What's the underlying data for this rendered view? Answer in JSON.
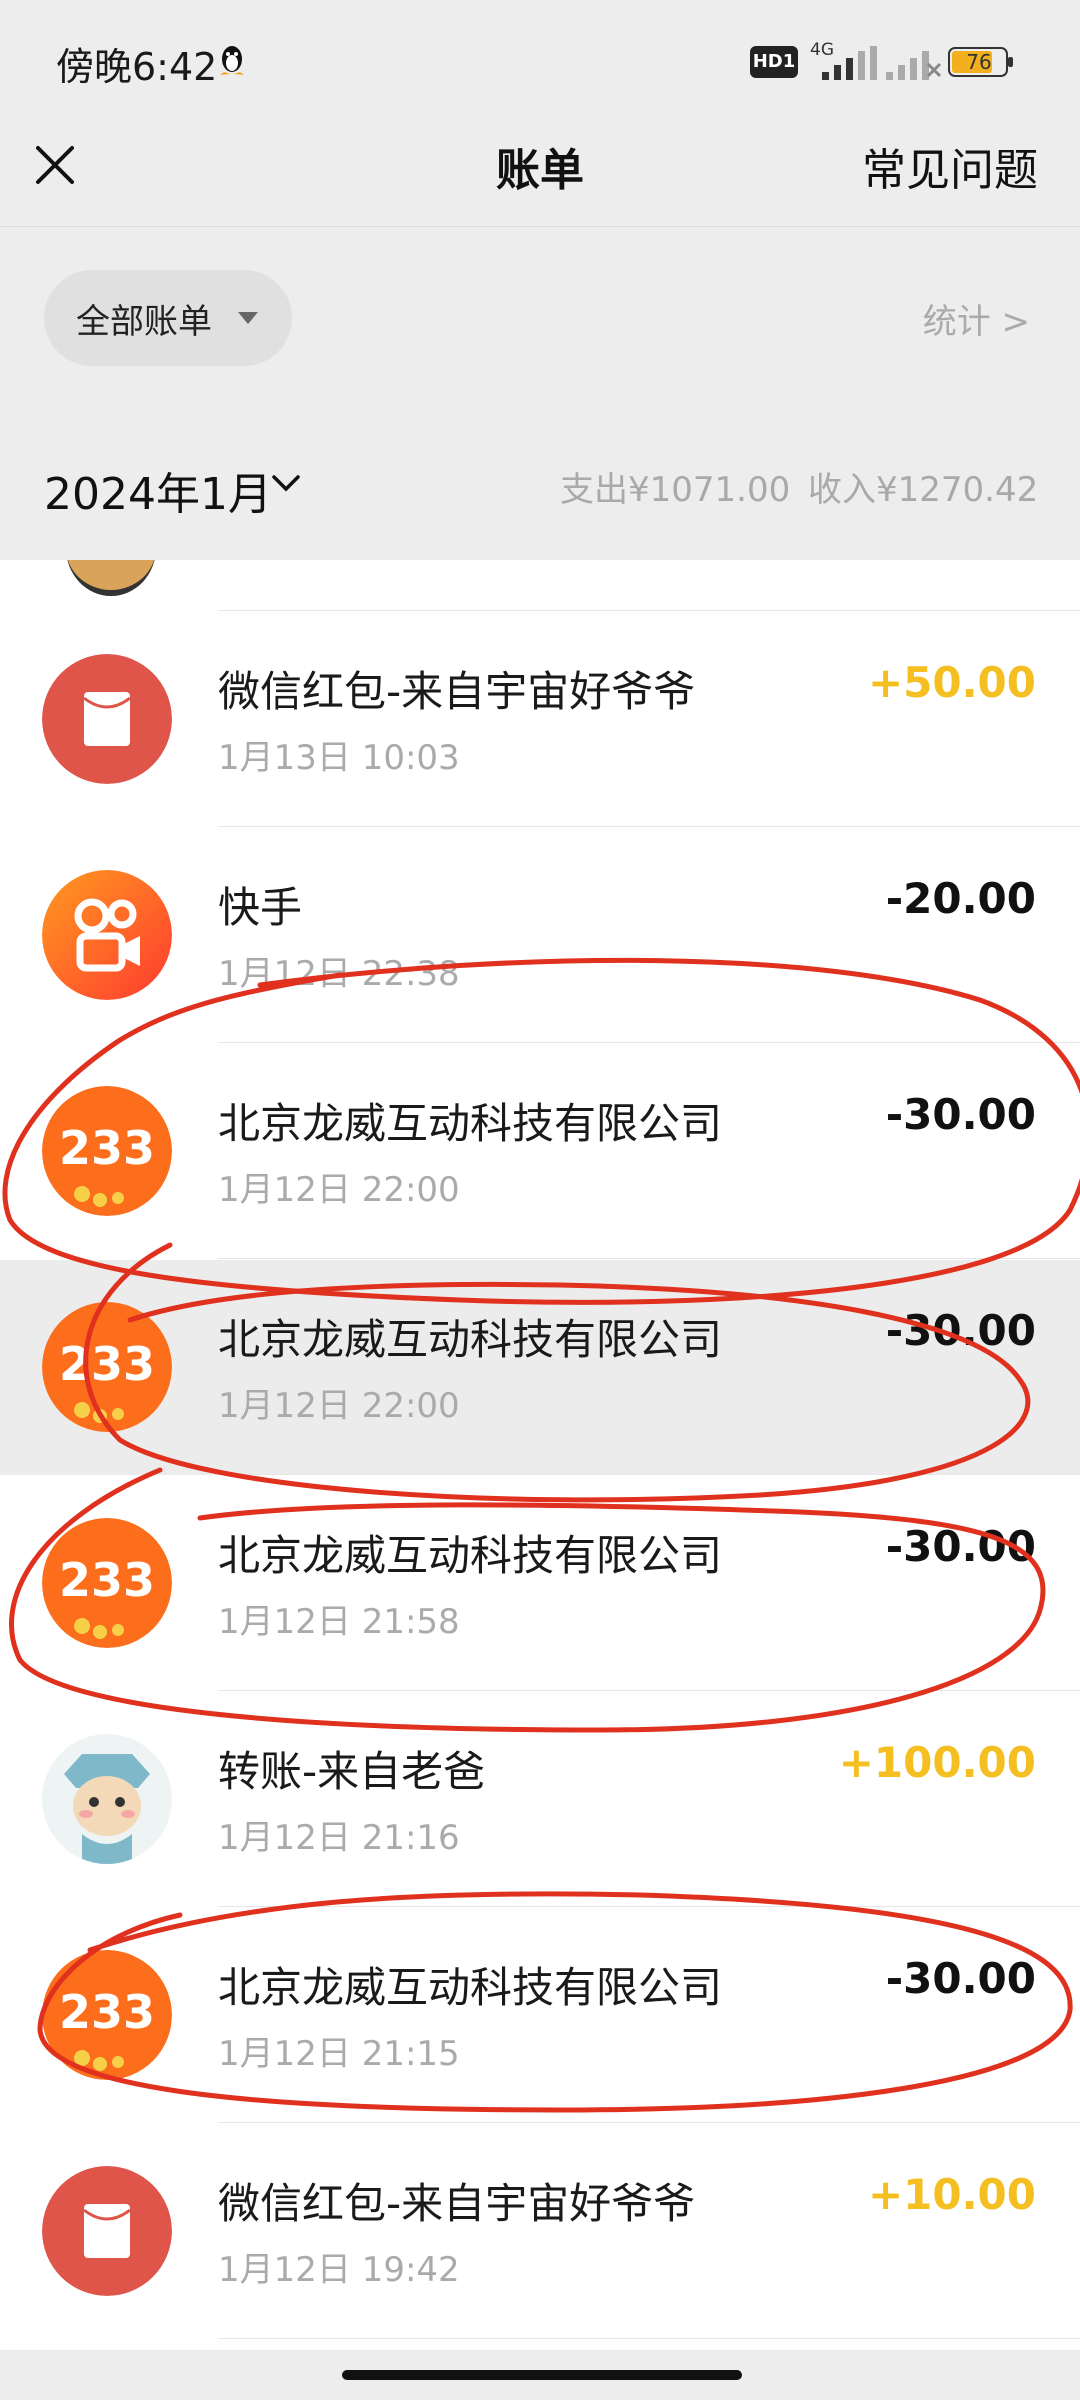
{
  "status_bar": {
    "time": "傍晚6:42",
    "hd_badge": "HD1",
    "network": "4G",
    "battery": "76"
  },
  "nav": {
    "title": "账单",
    "faq": "常见问题"
  },
  "filter": {
    "label": "全部账单",
    "stats": "统计 >"
  },
  "month": {
    "label": "2024年1月",
    "expense": "支出¥1071.00",
    "income": "收入¥1270.42"
  },
  "transactions": [
    {
      "title": "微信红包-来自宇宙好爷爷",
      "time": "1月13日 10:03",
      "amount": "+50.00",
      "type": "income",
      "icon": "red-packet-icon"
    },
    {
      "title": "快手",
      "time": "1月12日 22:38",
      "amount": "-20.00",
      "type": "expense",
      "icon": "kuaishou-icon"
    },
    {
      "title": "北京龙威互动科技有限公司",
      "time": "1月12日 22:00",
      "amount": "-30.00",
      "type": "expense",
      "icon": "233-app-icon"
    },
    {
      "title": "北京龙威互动科技有限公司",
      "time": "1月12日 22:00",
      "amount": "-30.00",
      "type": "expense",
      "icon": "233-app-icon"
    },
    {
      "title": "北京龙威互动科技有限公司",
      "time": "1月12日 21:58",
      "amount": "-30.00",
      "type": "expense",
      "icon": "233-app-icon"
    },
    {
      "title": "转账-来自老爸",
      "time": "1月12日 21:16",
      "amount": "+100.00",
      "type": "income",
      "icon": "cartoon-avatar-icon"
    },
    {
      "title": "北京龙威互动科技有限公司",
      "time": "1月12日 21:15",
      "amount": "-30.00",
      "type": "expense",
      "icon": "233-app-icon"
    },
    {
      "title": "微信红包-来自宇宙好爷爷",
      "time": "1月12日 19:42",
      "amount": "+10.00",
      "type": "income",
      "icon": "red-packet-icon"
    }
  ],
  "app_icon_text": "233",
  "colors": {
    "background": "#ededed",
    "income": "#f5bf21",
    "expense": "#111111",
    "red_packet": "#e0554a",
    "annotation": "#e0301e"
  }
}
